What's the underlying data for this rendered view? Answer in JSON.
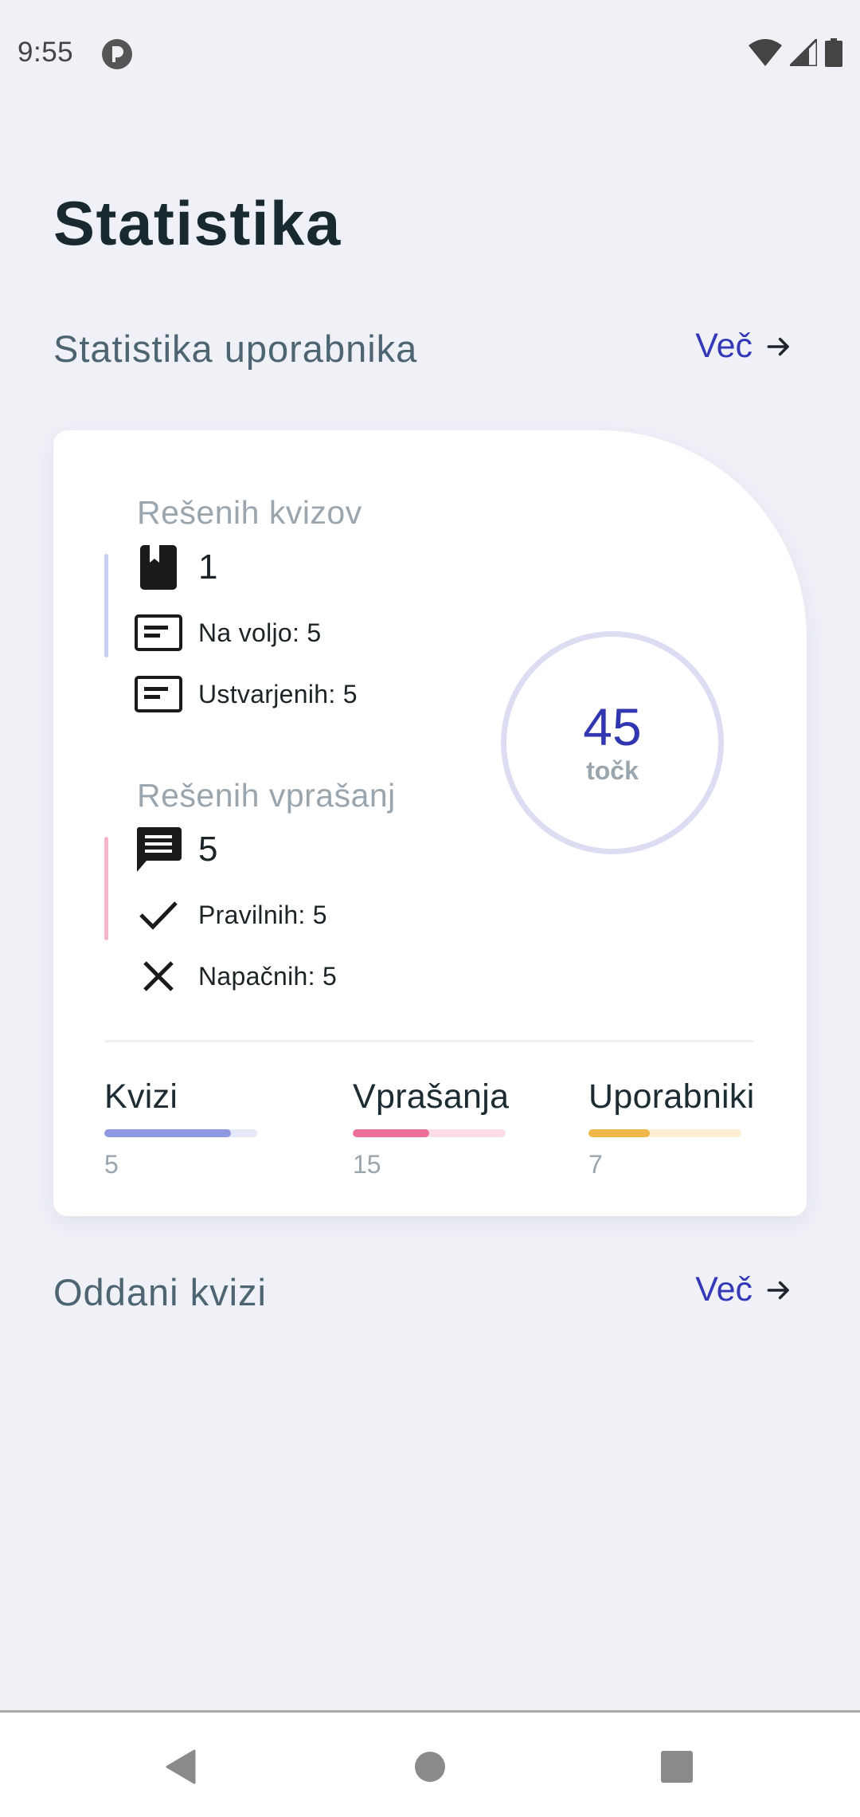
{
  "status_bar": {
    "time": "9:55",
    "icons": [
      "app-notification-icon",
      "wifi-icon",
      "signal-icon",
      "battery-icon"
    ]
  },
  "page": {
    "title": "Statistika"
  },
  "user_stats_section": {
    "title": "Statistika uporabnika",
    "more_label": "Več"
  },
  "card": {
    "quizzes": {
      "label": "Rešenih kvizov",
      "solved": "1",
      "available": "Na voljo: 5",
      "created": "Ustvarjenih: 5",
      "accent": "#c9cdf0"
    },
    "questions": {
      "label": "Rešenih vprašanj",
      "solved": "5",
      "correct": "Pravilnih: 5",
      "wrong": "Napačnih: 5",
      "accent": "#f5b6cc"
    },
    "points": {
      "value": "45",
      "label": "točk"
    },
    "totals": [
      {
        "label": "Kvizi",
        "count": "5",
        "fill_fraction": 0.83,
        "fill_color": "#8f98e0",
        "track_color": "#e5e8f8"
      },
      {
        "label": "Vprašanja",
        "count": "15",
        "fill_fraction": 0.5,
        "fill_color": "#ec7098",
        "track_color": "#fcdde6"
      },
      {
        "label": "Uporabniki",
        "count": "7",
        "fill_fraction": 0.4,
        "fill_color": "#f0b84a",
        "track_color": "#fdeed3"
      }
    ]
  },
  "submitted_section": {
    "title": "Oddani kvizi",
    "more_label": "Več"
  },
  "nav_bar": {
    "icons": [
      "back-icon",
      "home-icon",
      "recents-icon"
    ]
  }
}
